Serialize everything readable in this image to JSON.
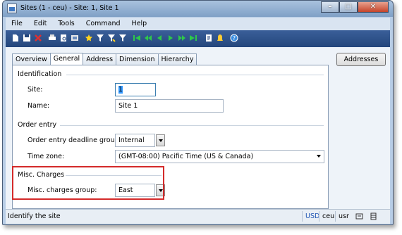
{
  "window": {
    "title": "Sites (1 - ceu) - Site: 1, Site 1"
  },
  "menu": [
    "File",
    "Edit",
    "Tools",
    "Command",
    "Help"
  ],
  "toolbar_icons": [
    "new-icon",
    "save-icon",
    "delete-icon",
    "print-icon",
    "print-preview-icon",
    "export-icon",
    "filter-by-selection-icon",
    "filter-icon",
    "advanced-filter-icon",
    "remove-filter-icon",
    "first-record-icon",
    "previous-page-icon",
    "previous-record-icon",
    "next-record-icon",
    "next-page-icon",
    "last-record-icon",
    "document-handling-icon",
    "alert-icon",
    "help-icon"
  ],
  "tabs": [
    {
      "label": "Overview",
      "active": false
    },
    {
      "label": "General",
      "active": true
    },
    {
      "label": "Address",
      "active": false
    },
    {
      "label": "Dimension",
      "active": false
    },
    {
      "label": "Hierarchy",
      "active": false
    }
  ],
  "addresses_button": "Addresses",
  "identification": {
    "title": "Identification",
    "site_label": "Site:",
    "site_value": "1",
    "name_label": "Name:",
    "name_value": "Site 1"
  },
  "order_entry": {
    "title": "Order entry",
    "deadline_label": "Order entry deadline group:",
    "deadline_value": "Internal",
    "timezone_label": "Time zone:",
    "timezone_value": "(GMT-08:00) Pacific Time (US & Canada)"
  },
  "misc_charges": {
    "title": "Misc. Charges",
    "group_label": "Misc. charges group:",
    "group_value": "East",
    "highlight_color": "#d42a2a"
  },
  "status": {
    "text": "Identify the site",
    "currency": "USD",
    "company": "ceu",
    "user": "usr"
  }
}
